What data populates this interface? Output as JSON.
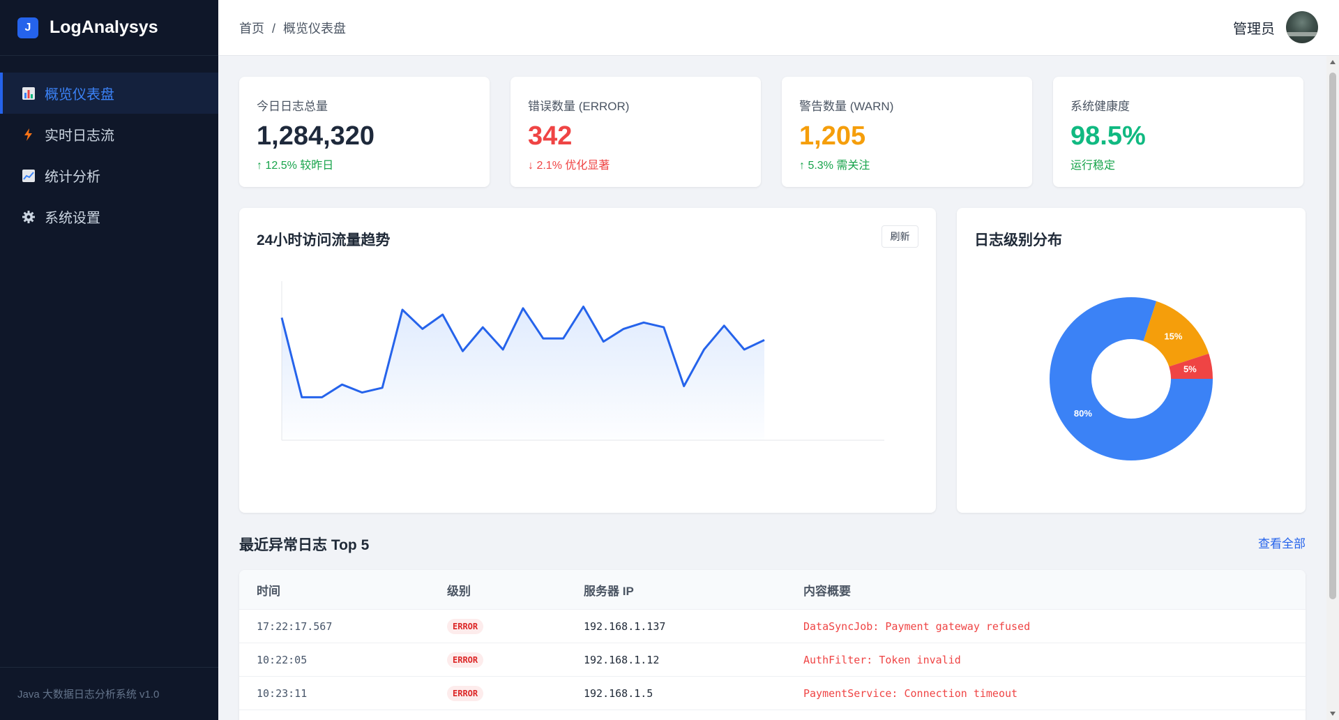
{
  "brand": {
    "logo_letter": "J",
    "name": "LogAnalysys"
  },
  "sidebar": {
    "items": [
      {
        "label": "概览仪表盘",
        "icon": "bar-chart-icon",
        "active": true
      },
      {
        "label": "实时日志流",
        "icon": "lightning-icon",
        "active": false
      },
      {
        "label": "统计分析",
        "icon": "line-chart-icon",
        "active": false
      },
      {
        "label": "系统设置",
        "icon": "gear-icon",
        "active": false
      }
    ],
    "footer": "Java 大数据日志分析系统 v1.0"
  },
  "header": {
    "breadcrumb_home": "首页",
    "breadcrumb_sep": "/",
    "breadcrumb_current": "概览仪表盘",
    "user_name": "管理员"
  },
  "stats": [
    {
      "label": "今日日志总量",
      "value": "1,284,320",
      "sub": "↑ 12.5% 较昨日",
      "value_color": "#1e293b",
      "sub_color": "#16a34a"
    },
    {
      "label": "错误数量 (ERROR)",
      "value": "342",
      "sub": "↓ 2.1% 优化显著",
      "value_color": "#ef4444",
      "sub_color": "#ef4444"
    },
    {
      "label": "警告数量 (WARN)",
      "value": "1,205",
      "sub": "↑ 5.3% 需关注",
      "value_color": "#f59e0b",
      "sub_color": "#16a34a"
    },
    {
      "label": "系统健康度",
      "value": "98.5%",
      "sub": "运行稳定",
      "value_color": "#10b981",
      "sub_color": "#16a34a"
    }
  ],
  "trend": {
    "title": "24小时访问流量趋势",
    "refresh_label": "刷新"
  },
  "pie": {
    "title": "日志级别分布"
  },
  "chart_data": [
    {
      "type": "area",
      "title": "24小时访问流量趋势",
      "x": [
        0,
        1,
        2,
        3,
        4,
        5,
        6,
        7,
        8,
        9,
        10,
        11,
        12,
        13,
        14,
        15,
        16,
        17,
        18,
        19,
        20,
        21,
        22,
        23,
        24
      ],
      "values": [
        77,
        27,
        27,
        35,
        30,
        33,
        82,
        70,
        79,
        56,
        71,
        57,
        83,
        64,
        64,
        84,
        62,
        70,
        74,
        71,
        34,
        57,
        72,
        57,
        63
      ],
      "ylim": [
        0,
        100
      ],
      "color": "#2563eb",
      "grid": false
    },
    {
      "type": "pie",
      "title": "日志级别分布",
      "slices": [
        {
          "label": "80%",
          "value": 80,
          "color": "#3b82f6"
        },
        {
          "label": "15%",
          "value": 15,
          "color": "#f59e0b"
        },
        {
          "label": "5%",
          "value": 5,
          "color": "#ef4444"
        }
      ],
      "donut": true
    }
  ],
  "recent": {
    "title": "最近异常日志 Top 5",
    "view_all": "查看全部",
    "columns": [
      "时间",
      "级别",
      "服务器 IP",
      "内容概要"
    ],
    "rows": [
      {
        "time": "17:22:17.567",
        "level": "ERROR",
        "ip": "192.168.1.137",
        "summary": "DataSyncJob: Payment gateway refused"
      },
      {
        "time": "10:22:05",
        "level": "ERROR",
        "ip": "192.168.1.12",
        "summary": "AuthFilter: Token invalid"
      },
      {
        "time": "10:23:11",
        "level": "ERROR",
        "ip": "192.168.1.5",
        "summary": "PaymentService: Connection timeout"
      },
      {
        "time": "",
        "level": "",
        "ip": "",
        "summary": ""
      }
    ]
  }
}
